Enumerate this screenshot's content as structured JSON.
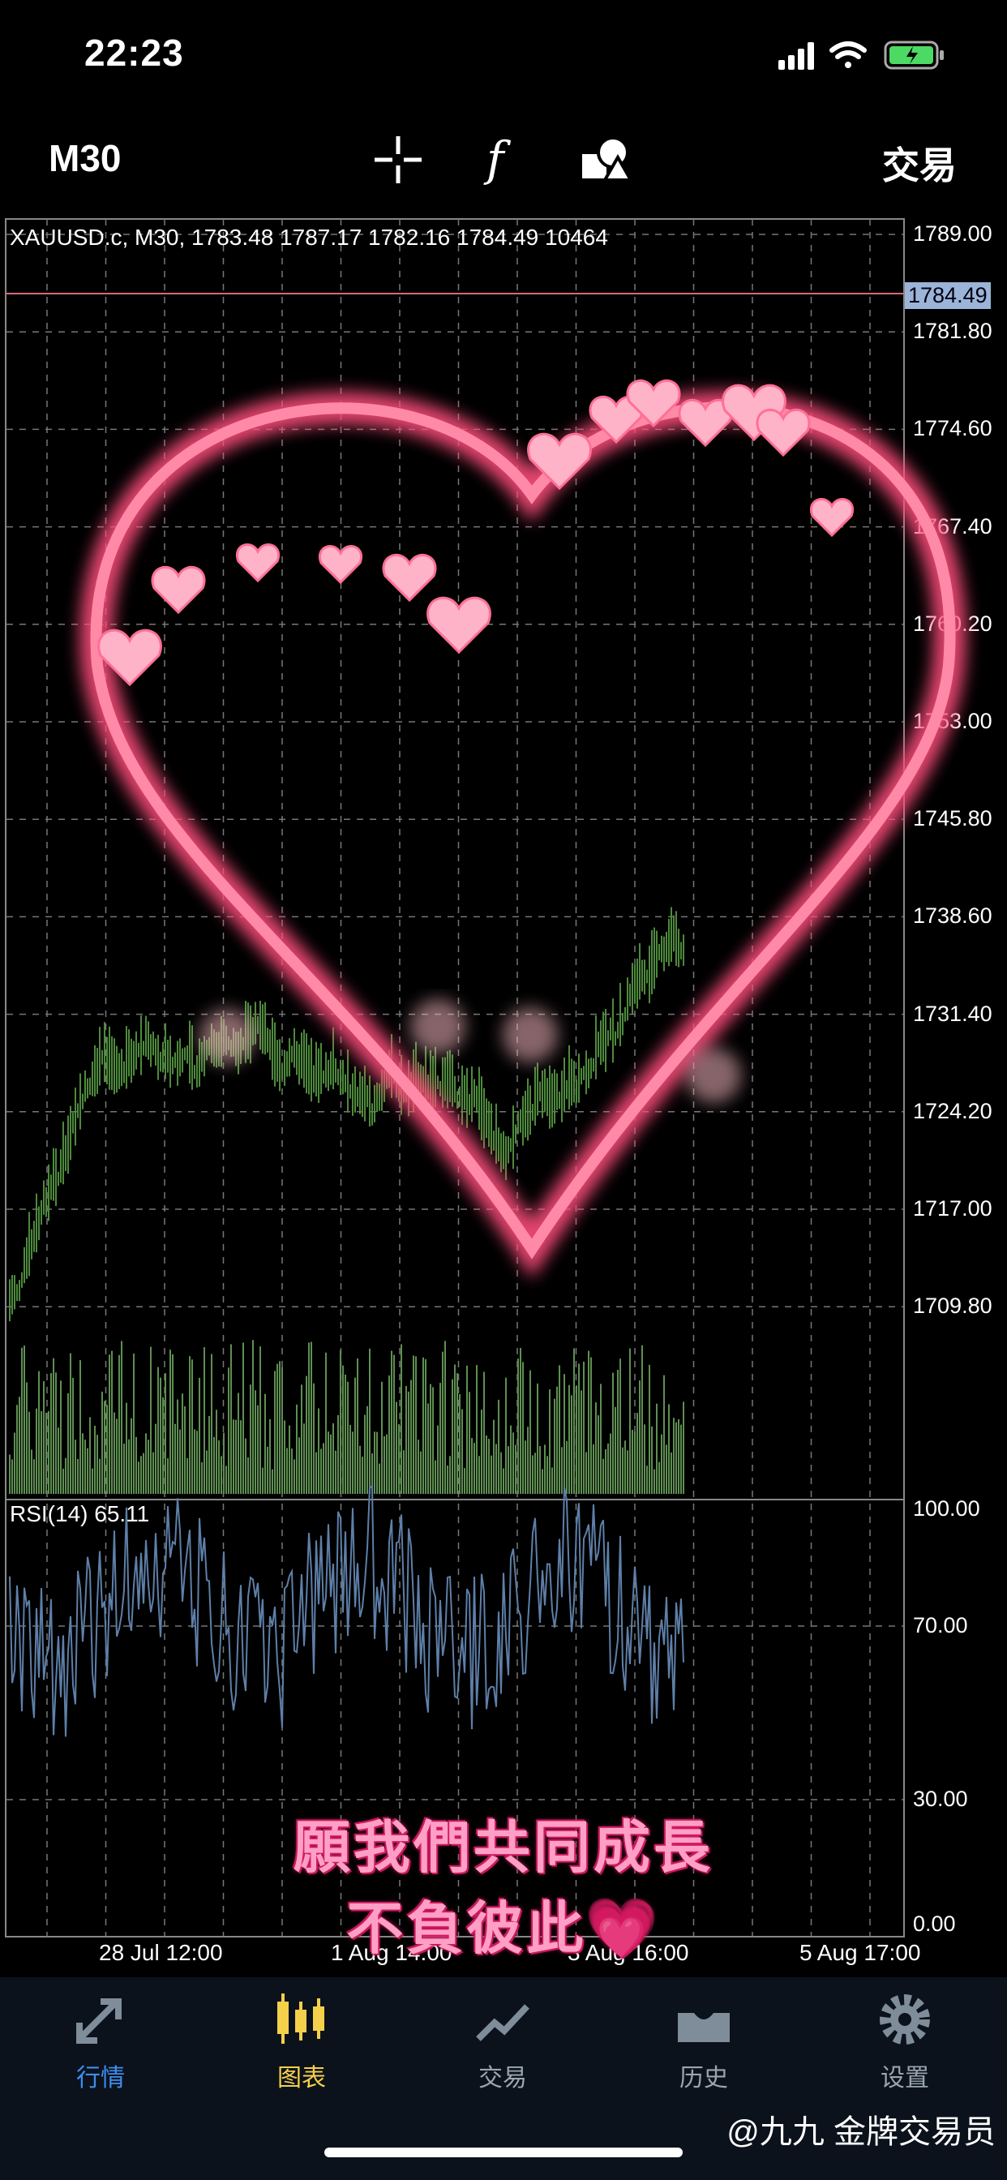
{
  "status_bar": {
    "time": "22:23"
  },
  "toolbar": {
    "timeframe": "M30",
    "trade_label": "交易",
    "icons": [
      "crosshair-icon",
      "function-icon",
      "objects-icon"
    ]
  },
  "chart": {
    "info_line": "XAUUSD.c, M30, 1783.48 1787.17 1782.16 1784.49 10464",
    "current_price": "1784.49",
    "price_levels": [
      "1789.00",
      "1781.80",
      "1774.60",
      "1767.40",
      "1760.20",
      "1753.00",
      "1745.80",
      "1738.60",
      "1731.40",
      "1724.20",
      "1717.00",
      "1709.80"
    ],
    "rsi_label": "RSI(14) 65.11",
    "rsi_levels": [
      "100.00",
      "70.00",
      "30.00",
      "0.00"
    ],
    "time_labels": [
      "28 Jul 12:00",
      "1 Aug 14:00",
      "3 Aug 16:00",
      "5 Aug 17:00"
    ],
    "colors": {
      "bull": "#4e8a3c",
      "rsi": "#5e7fa8",
      "price_line": "#d66a7a",
      "grid": "#7a7a7a"
    }
  },
  "overlay": {
    "line1": "願我們共同成長",
    "line2": "不負彼此💗"
  },
  "bottom_nav": {
    "items": [
      {
        "label": "行情",
        "icon": "quotes-icon"
      },
      {
        "label": "图表",
        "icon": "chart-icon"
      },
      {
        "label": "交易",
        "icon": "trade-icon"
      },
      {
        "label": "历史",
        "icon": "history-icon"
      },
      {
        "label": "设置",
        "icon": "gear-icon"
      }
    ]
  },
  "watermark": "@九九 金牌交易员"
}
